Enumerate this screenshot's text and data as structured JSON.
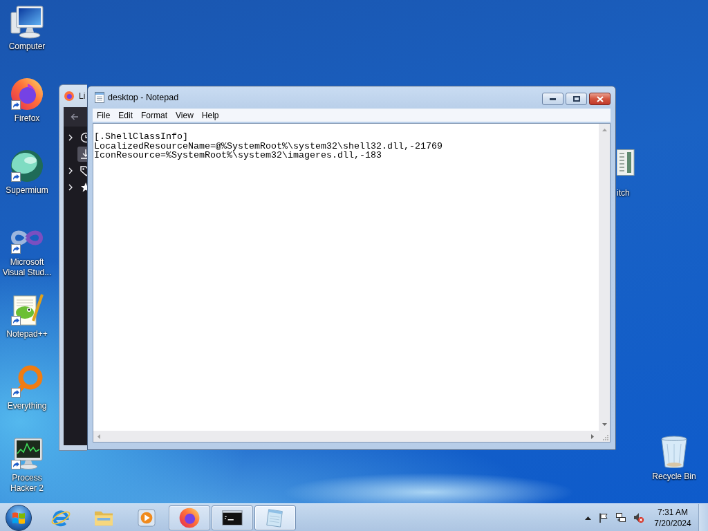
{
  "desktop_icons": [
    {
      "label": "Computer",
      "kind": "computer",
      "shortcut": false
    },
    {
      "label": "Firefox",
      "kind": "firefox",
      "shortcut": true
    },
    {
      "label": "Supermium",
      "kind": "supermium",
      "shortcut": true
    },
    {
      "label": "Microsoft Visual Stud...",
      "kind": "visual-studio",
      "shortcut": true
    },
    {
      "label": "Notepad++",
      "kind": "notepad-plus",
      "shortcut": true
    },
    {
      "label": "Everything",
      "kind": "everything",
      "shortcut": true
    },
    {
      "label": "Process Hacker 2",
      "kind": "process-hacker",
      "shortcut": true
    }
  ],
  "covered_icon": {
    "label": "itch"
  },
  "recycle_bin": {
    "label": "Recycle Bin"
  },
  "library_window": {
    "title": "Li",
    "items": [
      {
        "kind": "history",
        "expanded": false,
        "selected": false
      },
      {
        "kind": "downloads",
        "selected": true
      },
      {
        "kind": "tags",
        "expanded": false,
        "selected": false
      },
      {
        "kind": "bookmarks",
        "expanded": false,
        "selected": false
      }
    ]
  },
  "notepad": {
    "title": "desktop - Notepad",
    "menu": [
      "File",
      "Edit",
      "Format",
      "View",
      "Help"
    ],
    "lines": [
      "[.ShellClassInfo]",
      "LocalizedResourceName=@%SystemRoot%\\system32\\shell32.dll,-21769",
      "IconResource=%SystemRoot%\\system32\\imageres.dll,-183"
    ]
  },
  "taskbar": {
    "items": [
      {
        "kind": "ie",
        "running": false,
        "selected": false
      },
      {
        "kind": "explorer",
        "running": false,
        "selected": false
      },
      {
        "kind": "media-player",
        "running": false,
        "selected": false
      },
      {
        "kind": "firefox",
        "running": true,
        "selected": false
      },
      {
        "kind": "cmd",
        "running": true,
        "selected": false
      },
      {
        "kind": "notepad",
        "running": true,
        "selected": true
      }
    ],
    "tray": {
      "muted": true,
      "time": "7:31 AM",
      "date": "7/20/2024"
    }
  }
}
